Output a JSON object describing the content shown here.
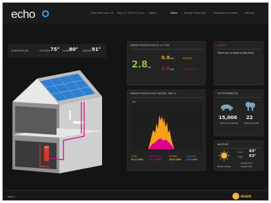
{
  "app": {
    "logo": "echo"
  },
  "header": {
    "greeting": "Good afternoon Art",
    "datetime": "May 12, 2009 2:25 pm",
    "logout": "Logout",
    "nav": [
      "Home",
      "Energy Production",
      "Temperature Profiles",
      "Settings"
    ]
  },
  "temperatures": {
    "label": "TEMPERATURE",
    "outside_label": "OUTSIDE",
    "outside_value": "75°",
    "home_label": "HOME",
    "home_value": "80°",
    "water_label": "WATER",
    "water_value": "91°"
  },
  "energy_now": {
    "title": "ENERGY PRODUCTION AT 2:17 PM",
    "total_value": "2.8",
    "total_unit": "kW",
    "heating_value": "0.8",
    "heating_unit": "kW",
    "heating_label": "HEATING",
    "electricity_value": "2.0",
    "electricity_unit": "kW",
    "electricity_label": "ELECTRICITY"
  },
  "alerts": {
    "title": "ALERTS",
    "message": "There are no alerts at this time"
  },
  "energy_day": {
    "title": "ENERGY PRODUCTION TUESDAY, MAY 12",
    "y_unit": "kW",
    "totals": [
      {
        "label": "TOTAL",
        "value": "32.5 kWh",
        "color": "#8cc63f"
      },
      {
        "label": "ELECTRICITY",
        "value": "13.7 kWh",
        "color": "#e0008a"
      },
      {
        "label": "HEATING",
        "value": "18.8 kWh",
        "color": "#f4a11c"
      },
      {
        "label": "COOLING",
        "value": "0.0 kWh",
        "color": "#3ea3e0"
      }
    ]
  },
  "system_benefits": {
    "title": "SYSTEM BENEFITS",
    "miles_value": "15,006",
    "miles_label": "MILES NOT DRIVEN",
    "trees_value": "22",
    "trees_label": "TREES PLANTED"
  },
  "weather": {
    "title": "WEATHER",
    "condition": "Mostly Cloudy",
    "low_label": "Low",
    "low_value": "43°",
    "high_label": "High",
    "high_value": "63°",
    "sunrise": "Sunrise 5:52",
    "sunset": "Sunset 8:02"
  },
  "footer": {
    "left": "ABOUT",
    "brand": "REGEN"
  },
  "colors": {
    "heating": "#f4a11c",
    "electricity": "#e0008a",
    "total": "#8cc63f",
    "accent": "#3ea3e0"
  }
}
